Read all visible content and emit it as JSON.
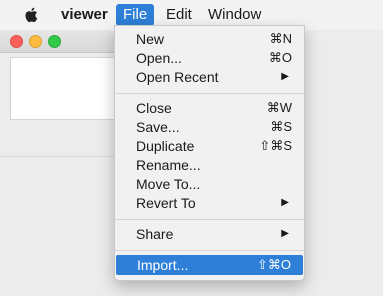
{
  "menubar": {
    "app_name": "viewer",
    "menus": [
      "File",
      "Edit",
      "Window"
    ]
  },
  "icons": {
    "apple": "apple-logo-icon",
    "submenu": "triangle-right-icon"
  },
  "colors": {
    "highlight": "#2d7fd7",
    "traffic_red": "#fc605c",
    "traffic_yellow": "#fdbc40",
    "traffic_green": "#34c84a"
  },
  "file_menu": {
    "items": [
      {
        "label": "New",
        "shortcut": "⌘N"
      },
      {
        "label": "Open...",
        "shortcut": "⌘O"
      },
      {
        "label": "Open Recent",
        "submenu_arrow": "▶"
      },
      {
        "label": "Close",
        "shortcut": "⌘W"
      },
      {
        "label": "Save...",
        "shortcut": "⌘S"
      },
      {
        "label": "Duplicate",
        "shortcut": "⇧⌘S"
      },
      {
        "label": "Rename..."
      },
      {
        "label": "Move To..."
      },
      {
        "label": "Revert To",
        "submenu_arrow": "▶"
      },
      {
        "label": "Share",
        "submenu_arrow": "▶"
      },
      {
        "label": "Import...",
        "shortcut": "⇧⌘O",
        "highlighted": true
      }
    ]
  }
}
